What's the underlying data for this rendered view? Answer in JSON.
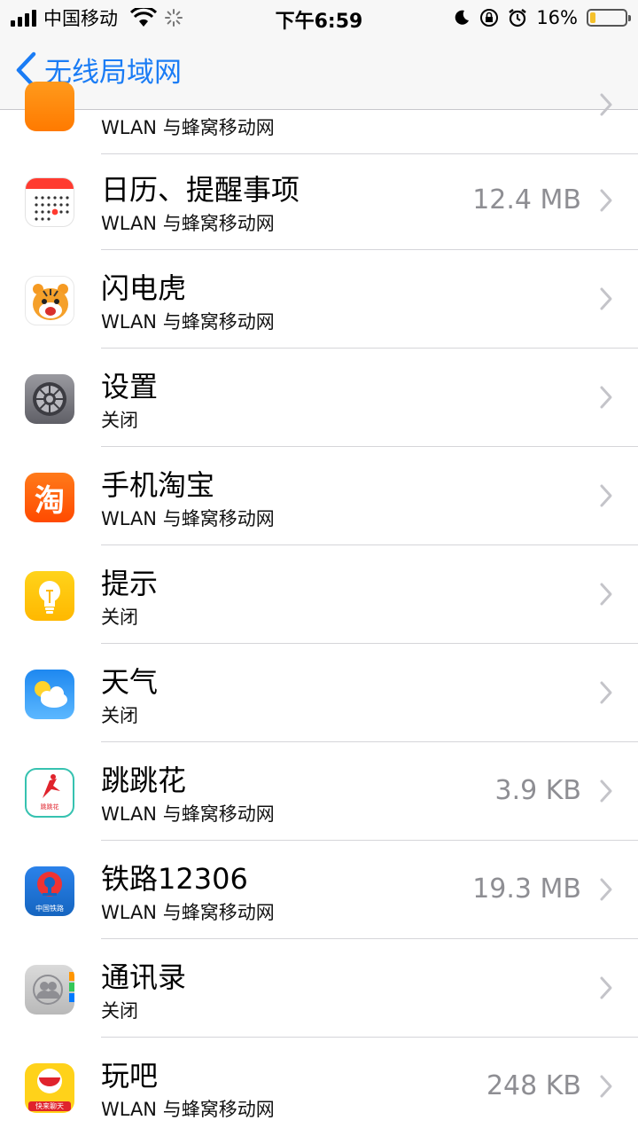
{
  "status_bar": {
    "carrier": "中国移动",
    "time": "下午6:59",
    "battery_percent": "16%",
    "battery_level": 0.16,
    "icons": [
      "signal-icon",
      "wifi-icon",
      "spinner-icon",
      "moon-icon",
      "rotation-lock-icon",
      "alarm-icon",
      "battery-icon"
    ]
  },
  "nav": {
    "back_label": "无线局域网",
    "accent": "#1a7cf5"
  },
  "apps": [
    {
      "name": "",
      "sub": "WLAN 与蜂窝移动网",
      "size": "",
      "icon": "orange-app-icon"
    },
    {
      "name": "日历、提醒事项",
      "sub": "WLAN 与蜂窝移动网",
      "size": "12.4 MB",
      "icon": "calendar-icon"
    },
    {
      "name": "闪电虎",
      "sub": "WLAN 与蜂窝移动网",
      "size": "",
      "icon": "tiger-icon"
    },
    {
      "name": "设置",
      "sub": "关闭",
      "size": "",
      "icon": "settings-gear-icon"
    },
    {
      "name": "手机淘宝",
      "sub": "WLAN 与蜂窝移动网",
      "size": "",
      "icon": "taobao-icon"
    },
    {
      "name": "提示",
      "sub": "关闭",
      "size": "",
      "icon": "tips-lightbulb-icon"
    },
    {
      "name": "天气",
      "sub": "关闭",
      "size": "",
      "icon": "weather-icon"
    },
    {
      "name": "跳跳花",
      "sub": "WLAN 与蜂窝移动网",
      "size": "3.9 KB",
      "icon": "tiaotiaohua-icon"
    },
    {
      "name": "铁路12306",
      "sub": "WLAN 与蜂窝移动网",
      "size": "19.3 MB",
      "icon": "railway-12306-icon"
    },
    {
      "name": "通讯录",
      "sub": "关闭",
      "size": "",
      "icon": "contacts-icon"
    },
    {
      "name": "玩吧",
      "sub": "WLAN 与蜂窝移动网",
      "size": "248 KB",
      "icon": "wanba-icon"
    }
  ],
  "icon_text": {
    "taobao": "淘",
    "tiaotiaohua": "跳跳花",
    "railway": "中国铁路",
    "wanba": "快来聊天"
  }
}
